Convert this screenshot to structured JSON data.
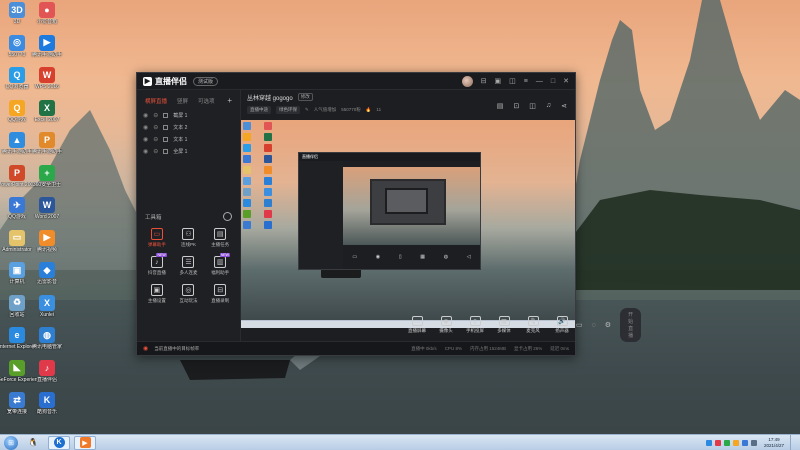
{
  "desktop": {
    "icons": [
      {
        "label": "3D",
        "color": "#4a8fd8",
        "glyph": "3D"
      },
      {
        "label": "小爱音箱",
        "color": "#e25555",
        "glyph": "●"
      },
      {
        "label": "550770",
        "color": "#3b8be0",
        "glyph": "◎"
      },
      {
        "label": "腾讯手游助手",
        "color": "#1d7be0",
        "glyph": "▶"
      },
      {
        "label": "QQ浏览器",
        "color": "#2a9de8",
        "glyph": "Q"
      },
      {
        "label": "WPS 2016",
        "color": "#d6402c",
        "glyph": "W"
      },
      {
        "label": "QQ游戏",
        "color": "#f5a623",
        "glyph": "Q"
      },
      {
        "label": "Excel 2007",
        "color": "#217346",
        "glyph": "X"
      },
      {
        "label": "腾讯手游助手",
        "color": "#2f8de0",
        "glyph": "▲"
      },
      {
        "label": "腾讯手游助手",
        "color": "#e08a2c",
        "glyph": "P"
      },
      {
        "label": "PowerPoint 2007",
        "color": "#d04a2a",
        "glyph": "P"
      },
      {
        "label": "360安全卫士",
        "color": "#2aa84a",
        "glyph": "+"
      },
      {
        "label": "QQ游戏",
        "color": "#3a78d6",
        "glyph": "✈"
      },
      {
        "label": "Word 2007",
        "color": "#2b579a",
        "glyph": "W"
      },
      {
        "label": "Administrator",
        "color": "#e5c36a",
        "glyph": "▭"
      },
      {
        "label": "腾讯视频",
        "color": "#f08c2a",
        "glyph": "▶"
      },
      {
        "label": "计算机",
        "color": "#5aa0e0",
        "glyph": "▣"
      },
      {
        "label": "迅雷影音",
        "color": "#2a7fd8",
        "glyph": "◆"
      },
      {
        "label": "回收站",
        "color": "#6fa0c8",
        "glyph": "♻"
      },
      {
        "label": "Xunlei",
        "color": "#3a8fe0",
        "glyph": "X"
      },
      {
        "label": "Internet Explorer",
        "color": "#2a8ae0",
        "glyph": "e"
      },
      {
        "label": "腾讯电脑管家",
        "color": "#2f7fd0",
        "glyph": "◍"
      },
      {
        "label": "GeForce Experience",
        "color": "#5a9e2a",
        "glyph": "◣"
      },
      {
        "label": "直播伴侣",
        "color": "#e03a4a",
        "glyph": "♪"
      },
      {
        "label": "宽带连接",
        "color": "#3a7ad0",
        "glyph": "⇄"
      },
      {
        "label": "酷狗音乐",
        "color": "#2a6fd0",
        "glyph": "K"
      }
    ]
  },
  "app": {
    "logo": "直播伴侣",
    "version": "测试版",
    "sidebar": {
      "tabs": [
        "横屏直播",
        "竖屏",
        "可选项"
      ],
      "scenes": [
        "截屏 1",
        "文本 2",
        "文本 1",
        "全屏 1"
      ],
      "tools_title": "工具箱",
      "tools": [
        {
          "label": "弹幕助手",
          "glyph": "▭",
          "active": true,
          "tag": ""
        },
        {
          "label": "连线PK",
          "glyph": "⚇",
          "active": false,
          "tag": ""
        },
        {
          "label": "主播任务",
          "glyph": "▤",
          "active": false,
          "tag": ""
        },
        {
          "label": "抖音直播",
          "glyph": "♪",
          "active": false,
          "tag": "NEW"
        },
        {
          "label": "多人连麦",
          "glyph": "☰",
          "active": false,
          "tag": ""
        },
        {
          "label": "福利助手",
          "glyph": "▥",
          "active": false,
          "tag": "NEW"
        },
        {
          "label": "主播设置",
          "glyph": "▣",
          "active": false,
          "tag": ""
        },
        {
          "label": "互动玩法",
          "glyph": "◎",
          "active": false,
          "tag": ""
        },
        {
          "label": "直播录制",
          "glyph": "⊟",
          "active": false,
          "tag": ""
        }
      ]
    },
    "room": {
      "title": "丛林穿越 gogogo",
      "edit_label": "修改",
      "sub": [
        "直播中途",
        "绿色环保",
        "人气值增加",
        "550770粉",
        "11"
      ]
    },
    "controls": [
      {
        "label": "直播屏幕",
        "glyph": "▭"
      },
      {
        "label": "摄像头",
        "glyph": "◉"
      },
      {
        "label": "手机投屏",
        "glyph": "▯"
      },
      {
        "label": "多媒体",
        "glyph": "▦"
      },
      {
        "label": "麦克风",
        "glyph": "🎙"
      },
      {
        "label": "扬声器",
        "glyph": "🔊"
      }
    ],
    "start_label": "开始直播",
    "status": {
      "notice": "当前直播中的目标帧率",
      "stats": [
        "直播中 0kb/s",
        "CPU 8%",
        "内存占用 1524MB",
        "显卡占用 26%",
        "延迟 0ms"
      ]
    }
  },
  "taskbar": {
    "time": "17:49",
    "date": "2021/4/27"
  }
}
